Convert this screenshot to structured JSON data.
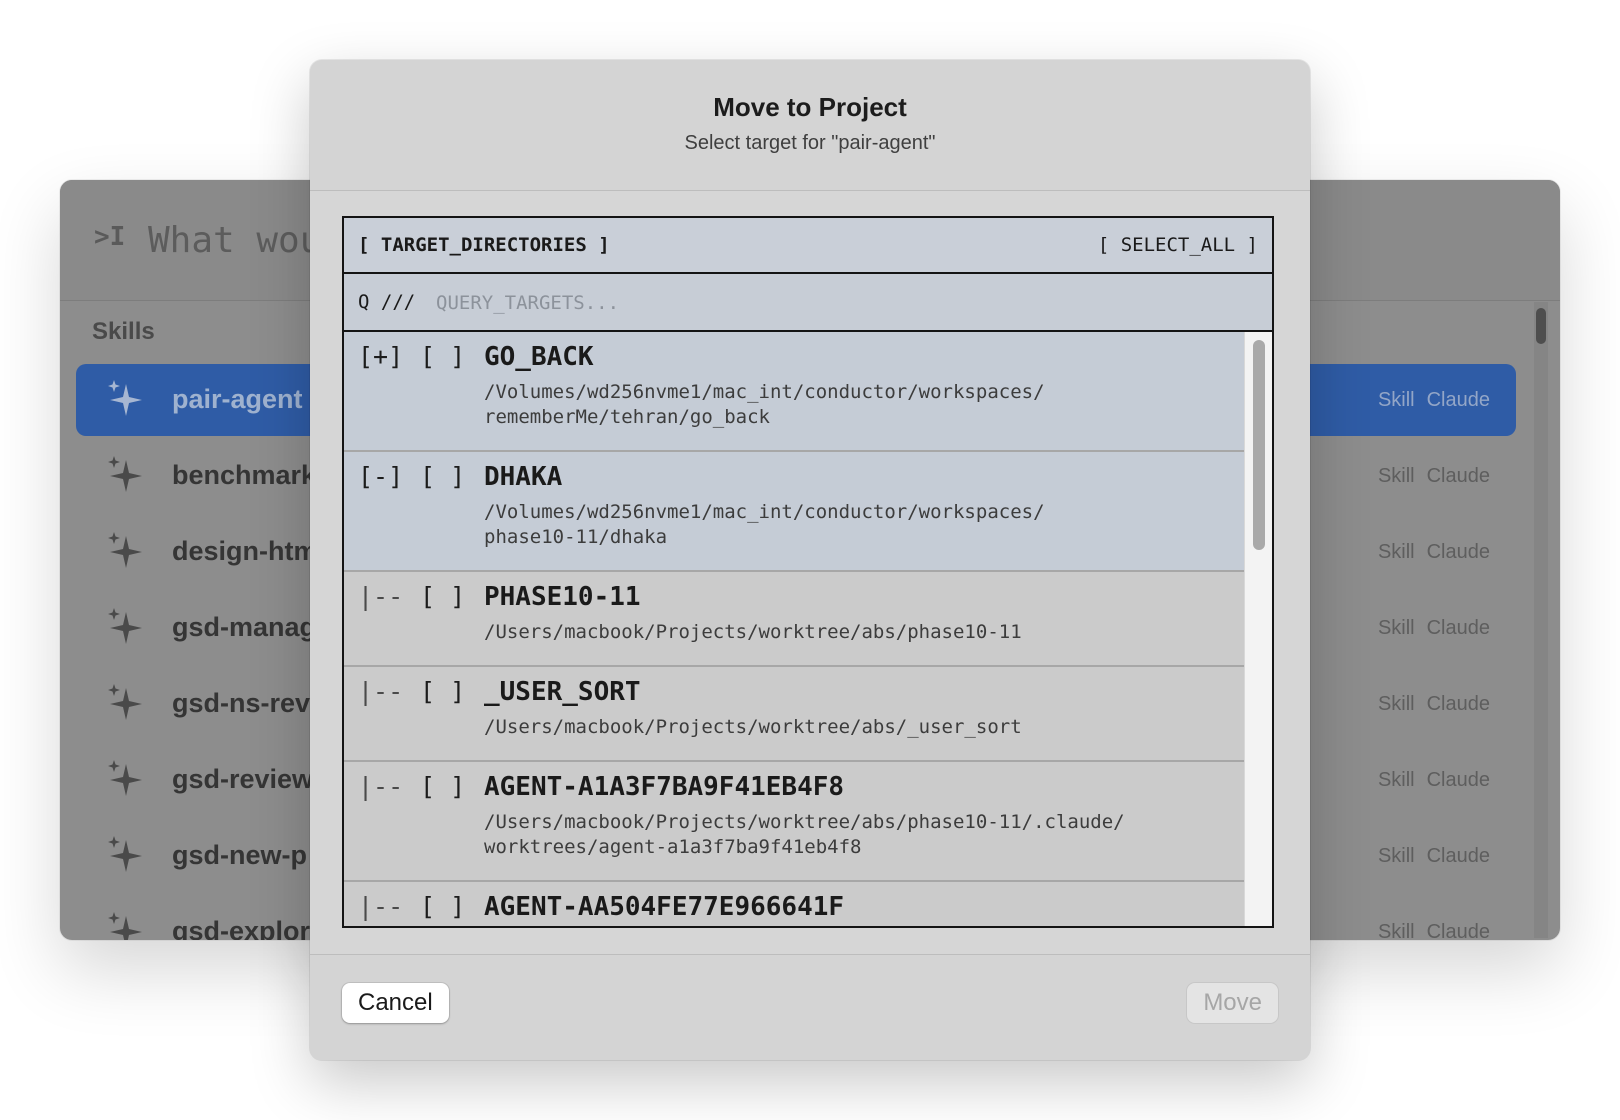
{
  "background": {
    "prompt_placeholder": "What wou",
    "section_label": "Skills",
    "skills": [
      {
        "name": "pair-agent",
        "type": "Skill",
        "source": "Claude",
        "active": true
      },
      {
        "name": "benchmark",
        "type": "Skill",
        "source": "Claude",
        "active": false
      },
      {
        "name": "design-htm",
        "type": "Skill",
        "source": "Claude",
        "active": false
      },
      {
        "name": "gsd-manag",
        "type": "Skill",
        "source": "Claude",
        "active": false
      },
      {
        "name": "gsd-ns-rev",
        "type": "Skill",
        "source": "Claude",
        "active": false
      },
      {
        "name": "gsd-review",
        "type": "Skill",
        "source": "Claude",
        "active": false
      },
      {
        "name": "gsd-new-p",
        "type": "Skill",
        "source": "Claude",
        "active": false
      },
      {
        "name": "gsd-explore",
        "type": "Skill",
        "source": "Claude",
        "active": false
      }
    ]
  },
  "modal": {
    "title": "Move to Project",
    "subtitle": "Select target for \"pair-agent\"",
    "panel_title": "[ TARGET_DIRECTORIES ]",
    "select_all": "[ SELECT_ALL ]",
    "search_prefix": "Q ///",
    "search_placeholder": "QUERY_TARGETS...",
    "search_value": "",
    "targets": [
      {
        "prefix": "[+]",
        "check": "[ ]",
        "name": "GO_BACK",
        "path": "/Volumes/wd256nvme1/mac_int/conductor/workspaces/\nrememberMe/tehran/go_back"
      },
      {
        "prefix": "[-]",
        "check": "[ ]",
        "name": "DHAKA",
        "path": "/Volumes/wd256nvme1/mac_int/conductor/workspaces/\nphase10-11/dhaka"
      },
      {
        "prefix": "|--",
        "check": "[ ]",
        "name": "PHASE10-11",
        "path": "/Users/macbook/Projects/worktree/abs/phase10-11"
      },
      {
        "prefix": "|--",
        "check": "[ ]",
        "name": "_USER_SORT",
        "path": "/Users/macbook/Projects/worktree/abs/_user_sort"
      },
      {
        "prefix": "|--",
        "check": "[ ]",
        "name": "AGENT-A1A3F7BA9F41EB4F8",
        "path": "/Users/macbook/Projects/worktree/abs/phase10-11/.claude/\nworktrees/agent-a1a3f7ba9f41eb4f8"
      },
      {
        "prefix": "|--",
        "check": "[ ]",
        "name": "AGENT-AA504FE77E966641F",
        "path": ""
      }
    ],
    "cancel_label": "Cancel",
    "move_label": "Move"
  },
  "colors": {
    "accent": "#2f5ca6",
    "modal_bg": "#d6d6d6",
    "panel_bg": "#cdd3dc"
  }
}
